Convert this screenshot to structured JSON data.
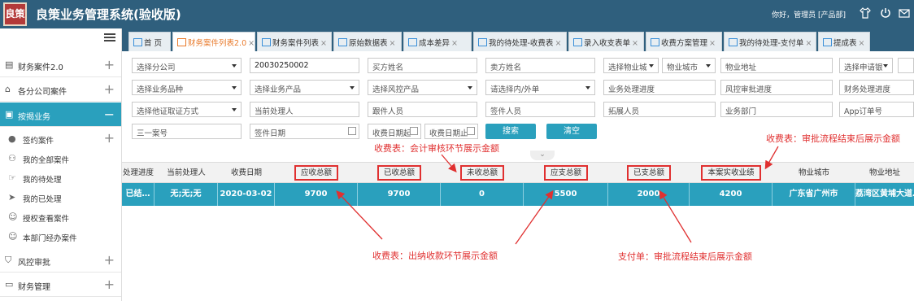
{
  "app": {
    "logo_text": "良策",
    "title": "良策业务管理系统(验收版)",
    "greeting": "你好，管理员 [产品部]"
  },
  "sidebar": {
    "items": [
      {
        "label": "财务案件2.0",
        "icon": "list-icon",
        "expander": "+"
      },
      {
        "label": "各分公司案件",
        "icon": "bank-icon",
        "expander": "+"
      },
      {
        "label": "按揭业务",
        "icon": "document-icon",
        "expander": "−"
      }
    ],
    "sub_items": [
      {
        "label": "签约案件",
        "icon": "user-icon",
        "expander": "+"
      },
      {
        "label": "我的全部案件",
        "icon": "nodes-icon"
      },
      {
        "label": "我的待处理",
        "icon": "hand-icon"
      },
      {
        "label": "我的已处理",
        "icon": "send-icon"
      },
      {
        "label": "授权查看案件",
        "icon": "users-icon"
      },
      {
        "label": "本部门经办案件",
        "icon": "users-icon"
      }
    ],
    "bottom_items": [
      {
        "label": "风控审批",
        "icon": "shield-icon",
        "expander": "+"
      },
      {
        "label": "财务管理",
        "icon": "wallet-icon",
        "expander": "+"
      }
    ]
  },
  "tabs": [
    {
      "label": "首 页",
      "closable": false
    },
    {
      "label": "财务案件列表2.0",
      "closable": true
    },
    {
      "label": "财务案件列表",
      "closable": true
    },
    {
      "label": "原始数据表",
      "closable": true
    },
    {
      "label": "成本差异",
      "closable": true
    },
    {
      "label": "我的待处理-收费表",
      "closable": true
    },
    {
      "label": "录入收支表单",
      "closable": true
    },
    {
      "label": "收费方案管理",
      "closable": true
    },
    {
      "label": "我的待处理-支付单",
      "closable": true
    },
    {
      "label": "提成表",
      "closable": true
    }
  ],
  "tab_close_glyph": "×",
  "filters": {
    "row1": [
      "选择分公司",
      "20030250002",
      "买方姓名",
      "卖方姓名",
      "选择物业城",
      "物业城市",
      "物业地址",
      "选择申请银"
    ],
    "row2": [
      "选择业务品种",
      "选择业务产品",
      "选择风控产品",
      "请选择内/外单",
      "业务处理进度",
      "风控审批进度",
      "财务处理进度"
    ],
    "row3": [
      "选择他证取证方式",
      "当前处理人",
      "跟件人员",
      "签件人员",
      "拓展人员",
      "业务部门",
      "App订单号"
    ],
    "row4": [
      "三一案号",
      "签件日期",
      "收费日期起",
      "收费日期止"
    ]
  },
  "buttons": {
    "search": "搜索",
    "clear": "清空"
  },
  "table": {
    "columns": [
      "处理进度",
      "当前处理人",
      "收费日期",
      "应收总额",
      "已收总额",
      "未收总额",
      "应支总额",
      "已支总额",
      "本案实收业绩",
      "物业城市",
      "物业地址"
    ],
    "row": [
      "已结…",
      "无;无;无",
      "2020-03-02",
      "9700",
      "9700",
      "0",
      "5500",
      "2000",
      "4200",
      "广东省广州市",
      "荔湾区黄埔大道…"
    ]
  },
  "annotations": {
    "audit_note": "收费表：会计审核环节展示金额",
    "fee_flow_note": "收费表：审批流程结束后展示金额",
    "cashier_note": "收费表：出纳收款环节展示金额",
    "payment_note": "支付单：审批流程结束后展示金额",
    "color": "#e03030"
  },
  "theme": {
    "header": "#2f5f7d",
    "accent": "#2aa0bd",
    "active_tab_text": "#e97a2b"
  }
}
